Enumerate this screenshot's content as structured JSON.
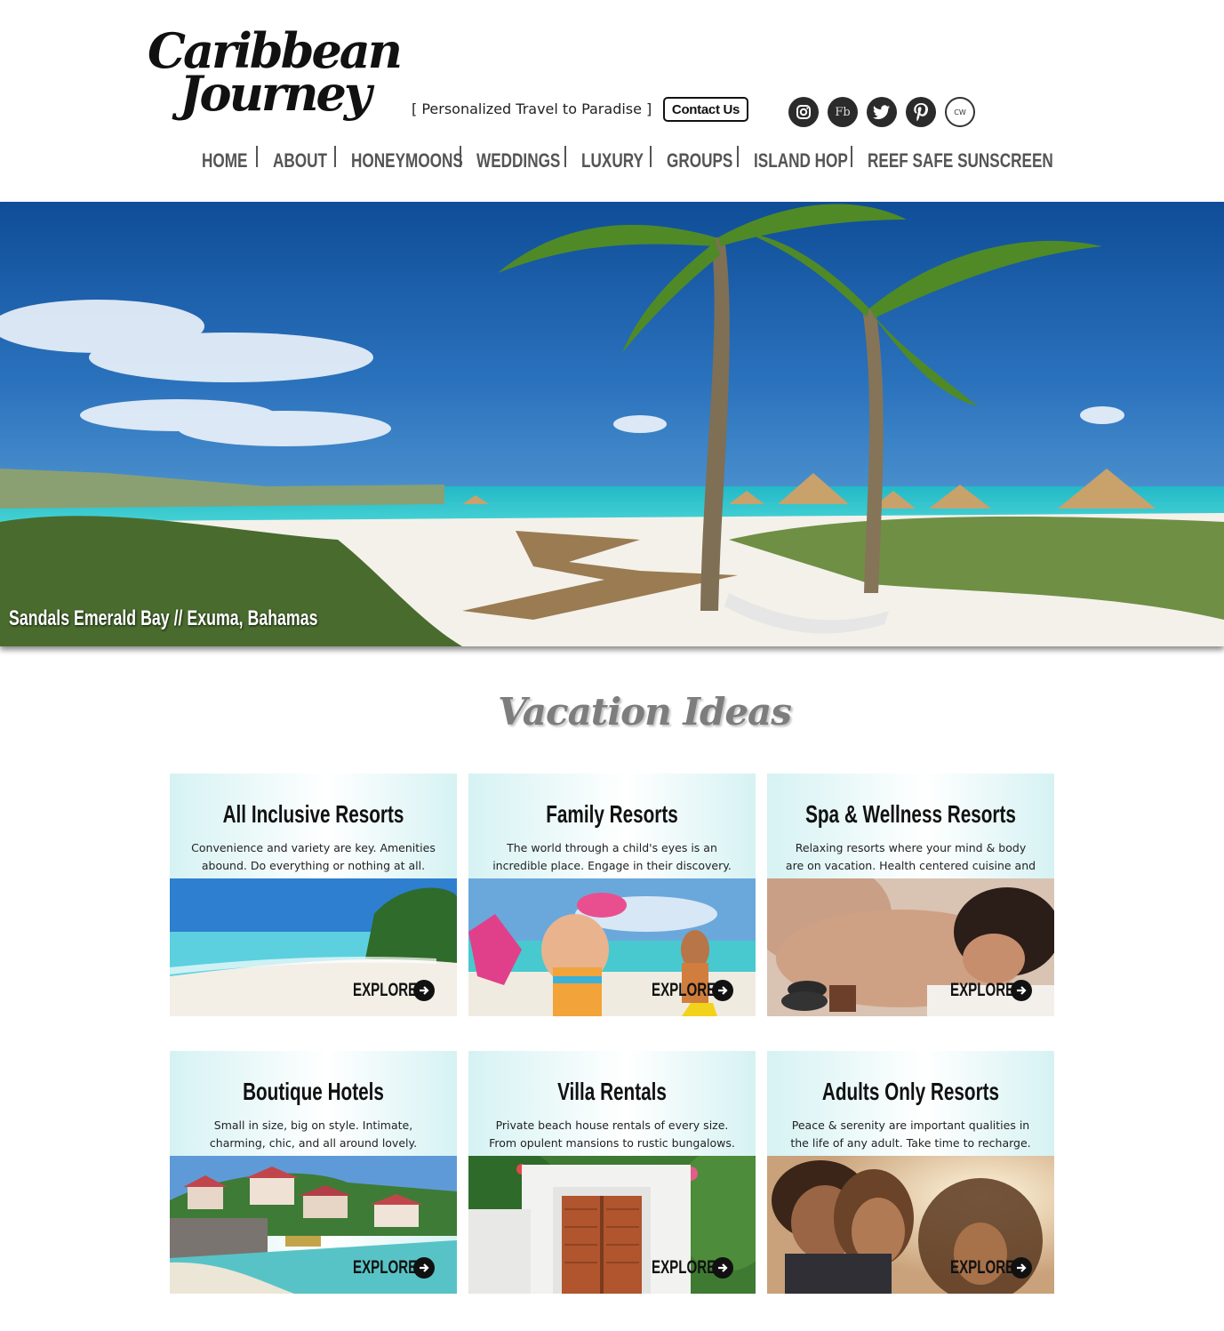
{
  "logo": {
    "line1": "Caribbean",
    "line2": "Journey"
  },
  "header": {
    "tagline": "[ Personalized Travel to Paradise ]",
    "contact_label": "Contact Us",
    "social": [
      {
        "name": "instagram",
        "icon": "instagram-icon"
      },
      {
        "name": "facebook",
        "label": "Fb",
        "icon": "facebook-icon"
      },
      {
        "name": "twitter",
        "icon": "twitter-icon"
      },
      {
        "name": "pinterest",
        "icon": "pinterest-icon"
      },
      {
        "name": "cw",
        "label": "CW",
        "icon": "cw-icon"
      }
    ]
  },
  "nav": {
    "items": [
      "HOME",
      "ABOUT",
      "HONEYMOONS",
      "WEDDINGS",
      "LUXURY",
      "GROUPS",
      "ISLAND HOP",
      "REEF SAFE SUNSCREEN"
    ]
  },
  "hero": {
    "caption": "Sandals Emerald Bay // Exuma, Bahamas"
  },
  "section": {
    "title": "Vacation Ideas"
  },
  "cards": [
    {
      "title": "All Inclusive Resorts",
      "desc": "Convenience and variety are key. Amenities abound. Do everything or nothing at all.",
      "cta": "EXPLORE"
    },
    {
      "title": "Family Resorts",
      "desc": "The world through a child's eyes is an incredible place. Engage in their discovery.",
      "cta": "EXPLORE"
    },
    {
      "title": "Spa & Wellness Resorts",
      "desc": "Relaxing resorts where your mind & body are on vacation. Health centered cuisine and soothing.",
      "cta": "EXPLORE"
    },
    {
      "title": "Boutique Hotels",
      "desc": "Small in size, big on style. Intimate, charming, chic, and all around lovely.",
      "cta": "EXPLORE"
    },
    {
      "title": "Villa Rentals",
      "desc": "Private beach house rentals of every size. From opulent mansions to rustic bungalows.",
      "cta": "EXPLORE"
    },
    {
      "title": "Adults Only Resorts",
      "desc": "Peace & serenity are important qualities in the life of any adult. Take time to recharge.",
      "cta": "EXPLORE"
    }
  ],
  "colors": {
    "nav_text": "#555555",
    "title_gray": "#7d7d7d",
    "card_tint": "#d6f2f3",
    "sea": "#2fc6cf",
    "sky": "#1b5fa8"
  }
}
